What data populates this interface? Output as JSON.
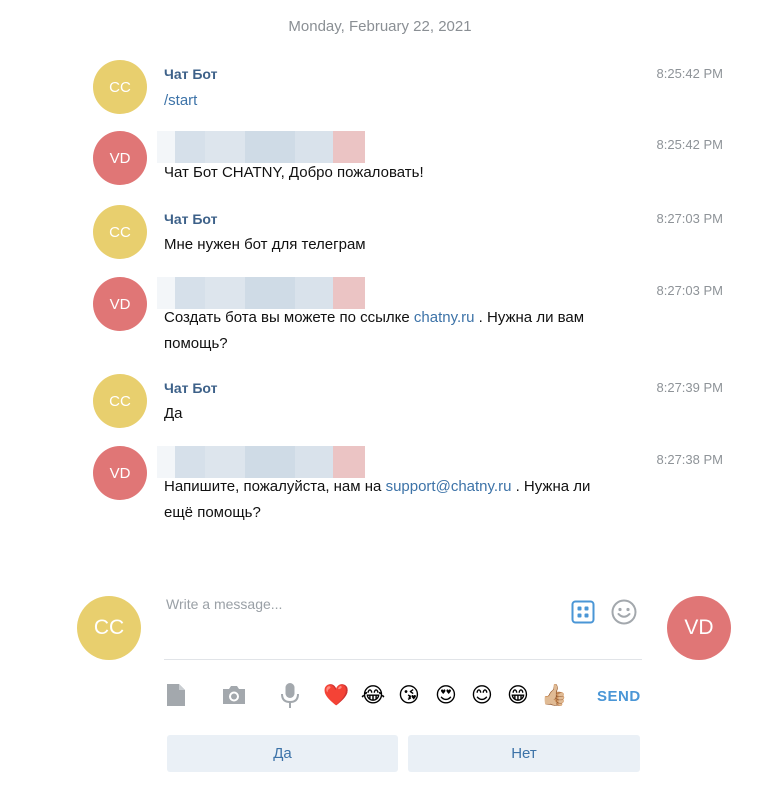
{
  "date_separator": "Monday, February 22, 2021",
  "messages": [
    {
      "sender": "Чат Бот",
      "avatar": "CC",
      "time": "8:25:42 PM",
      "text": "/start",
      "is_command": true
    },
    {
      "sender": "",
      "avatar": "VD",
      "time": "8:25:42 PM",
      "text": "Чат Бот CHATNY, Добро пожаловать!"
    },
    {
      "sender": "Чат Бот",
      "avatar": "CC",
      "time": "8:27:03 PM",
      "text": "Мне нужен бот для телеграм"
    },
    {
      "sender": "",
      "avatar": "VD",
      "time": "8:27:03 PM",
      "text_before": "Создать бота вы можете по ссылке ",
      "link": "chatny.ru",
      "text_after": " . Нужна ли вам",
      "text_line2": "помощь?"
    },
    {
      "sender": "Чат Бот",
      "avatar": "CC",
      "time": "8:27:39 PM",
      "text": "Да"
    },
    {
      "sender": "",
      "avatar": "VD",
      "time": "8:27:38 PM",
      "text_before": "Напишите, пожалуйста, нам на ",
      "link": "support@chatny.ru",
      "text_after": " . Нужна ли",
      "text_line2": "ещё помощь?"
    }
  ],
  "composer": {
    "left_avatar": "CC",
    "right_avatar": "VD",
    "placeholder": "Write a message...",
    "send_label": "SEND",
    "emojis": [
      "❤️",
      "😂",
      "😘",
      "😍",
      "😊",
      "😁",
      "👍🏼"
    ]
  },
  "quick_replies": [
    "Да",
    "Нет"
  ],
  "colors": {
    "bot_avatar": "#e8cf6e",
    "user_avatar": "#e07676",
    "sender_name": "#3d6189",
    "link": "#3d73a8",
    "send": "#4a96d6",
    "quick_reply_bg": "#eaf0f6"
  }
}
